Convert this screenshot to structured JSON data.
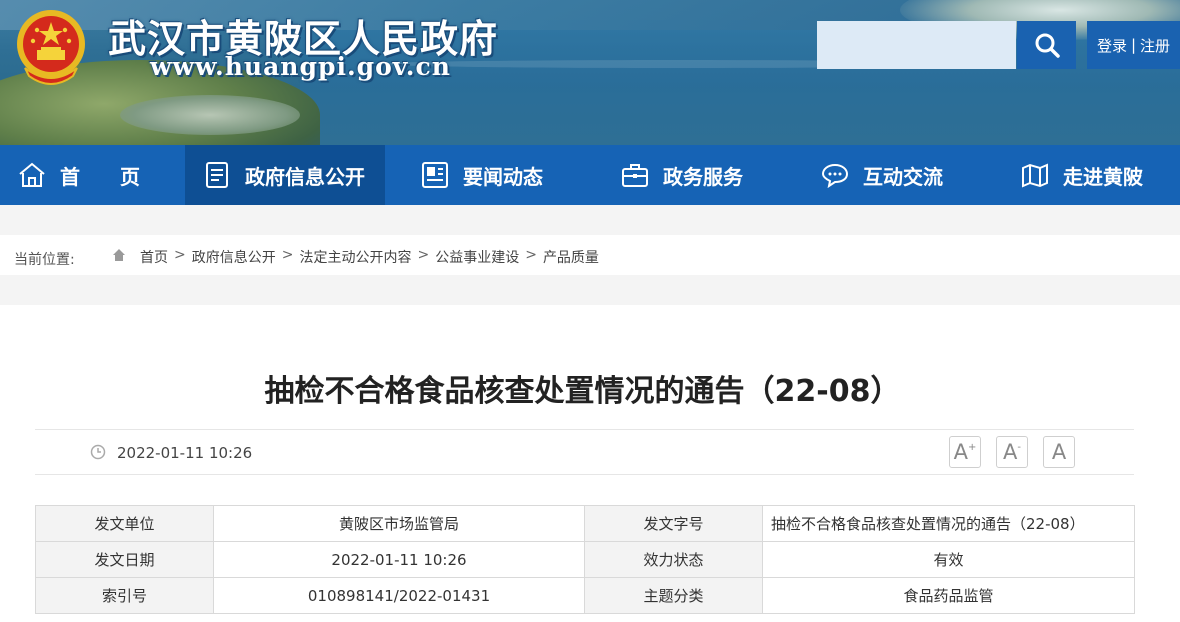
{
  "header": {
    "site_title": "武汉市黄陂区人民政府",
    "site_url": "www.huangpi.gov.cn",
    "search_placeholder": "",
    "login_label": "登录",
    "separator": "|",
    "register_label": "注册"
  },
  "nav": {
    "items": [
      {
        "label": "首　　页",
        "icon": "home-icon"
      },
      {
        "label": "政府信息公开",
        "icon": "document-icon"
      },
      {
        "label": "要闻动态",
        "icon": "news-icon"
      },
      {
        "label": "政务服务",
        "icon": "briefcase-icon"
      },
      {
        "label": "互动交流",
        "icon": "chat-icon"
      },
      {
        "label": "走进黄陂",
        "icon": "map-icon"
      }
    ],
    "active_index": 1
  },
  "breadcrumb": {
    "label": "当前位置:",
    "items": [
      "首页",
      "政府信息公开",
      "法定主动公开内容",
      "公益事业建设",
      "产品质量"
    ],
    "separator": ">"
  },
  "article": {
    "title": "抽检不合格食品核查处置情况的通告（22-08）",
    "pub_date": "2022-01-11 10:26",
    "font_buttons": [
      "A",
      "A",
      "A"
    ]
  },
  "info_table": {
    "rows": [
      [
        "发文单位",
        "黄陂区市场监管局",
        "发文字号",
        "抽检不合格食品核查处置情况的通告（22-08）"
      ],
      [
        "发文日期",
        "2022-01-11 10:26",
        "效力状态",
        "有效"
      ],
      [
        "索引号",
        "010898141/2022-01431",
        "主题分类",
        "食品药品监管"
      ]
    ]
  },
  "colors": {
    "nav_bg": "#1663b5",
    "nav_active": "#0e4f94",
    "search_button": "#1a62b0"
  }
}
